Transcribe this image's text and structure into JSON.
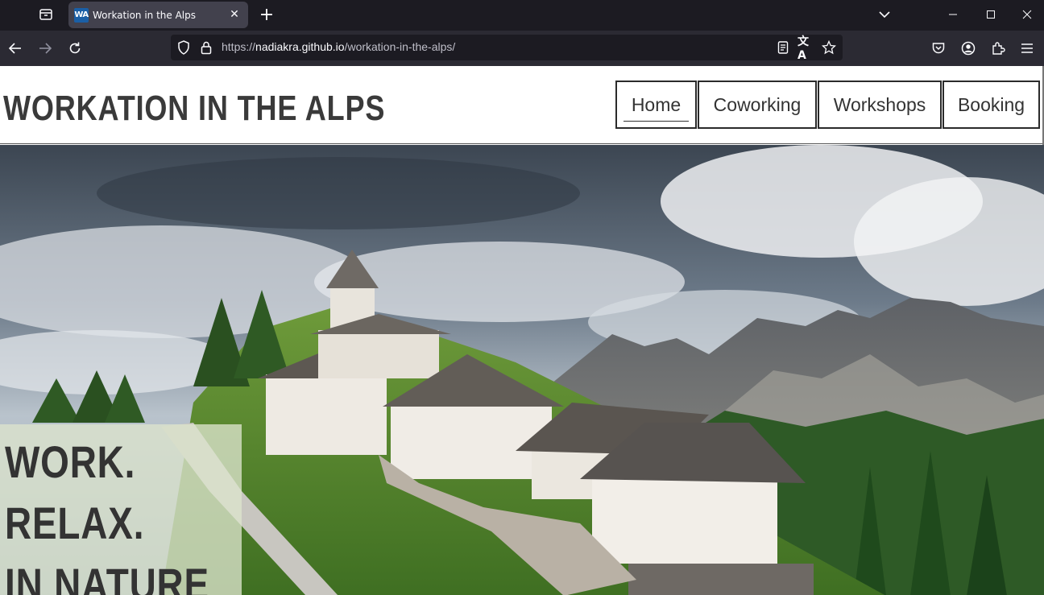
{
  "browser": {
    "tab_title": "Workation in the Alps",
    "favicon_text": "WA",
    "url_prefix": "https://",
    "url_host": "nadiakra.github.io",
    "url_path": "/workation-in-the-alps/"
  },
  "site": {
    "logo": "WORKATION IN THE ALPS",
    "menu": [
      {
        "label": "Home",
        "active": true
      },
      {
        "label": "Coworking",
        "active": false
      },
      {
        "label": "Workshops",
        "active": false
      },
      {
        "label": "Booking",
        "active": false
      }
    ],
    "hero": {
      "image_alt_icon": "alpine-village-photo",
      "tagline": [
        "WORK.",
        "RELAX.",
        "IN NATURE"
      ]
    }
  },
  "colors": {
    "browser_dark": "#1c1b22",
    "toolbar": "#2b2a33",
    "tab_active": "#42414d",
    "text_dark": "#3a3a3a",
    "tagline_box": "#dce4cd"
  }
}
